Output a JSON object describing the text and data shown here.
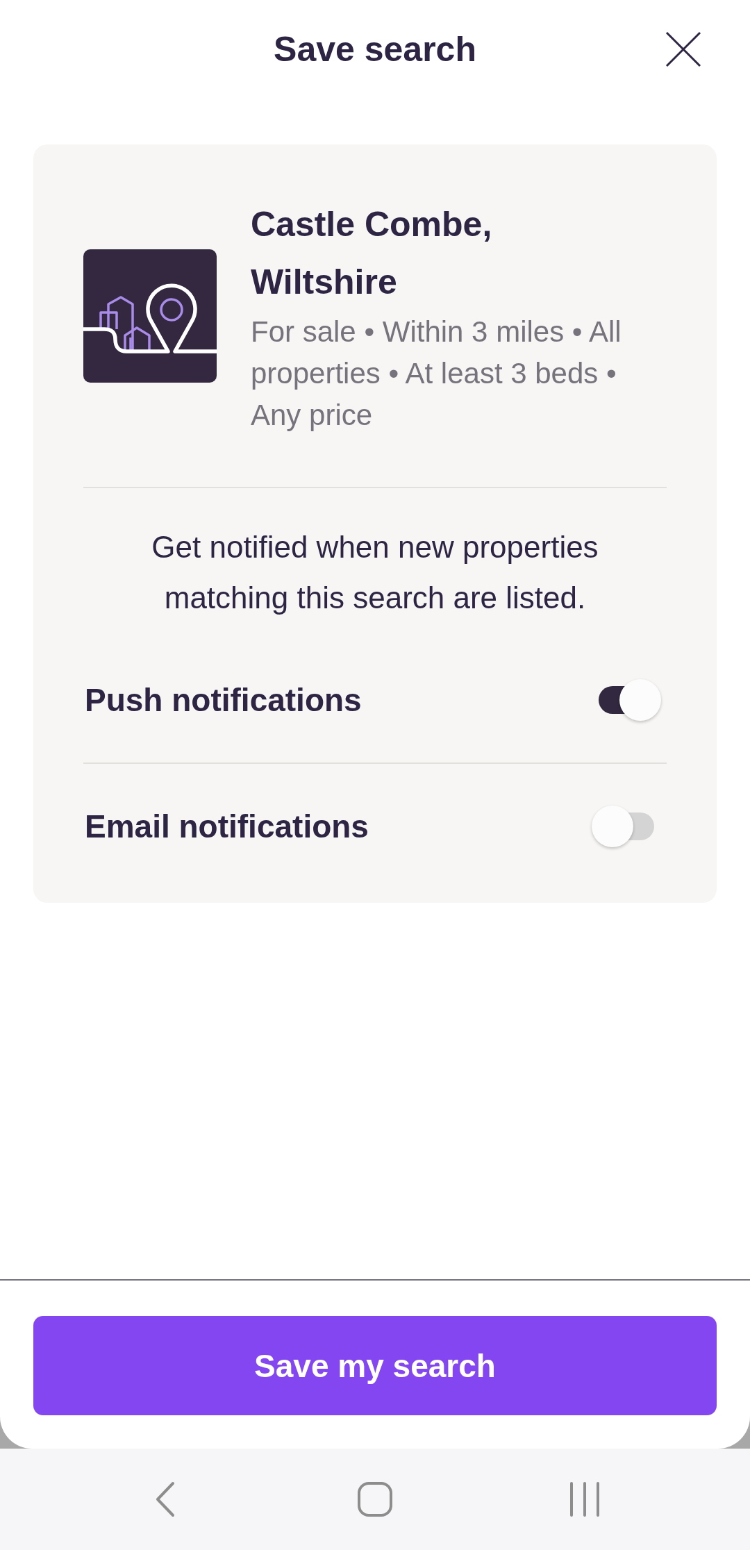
{
  "header": {
    "title": "Save search"
  },
  "search_card": {
    "location": "Castle Combe, Wiltshire",
    "criteria": "For sale • Within 3 miles • All properties • At least 3 beds • Any price",
    "description": "Get notified when new properties matching this search are listed.",
    "notifications": [
      {
        "label": "Push notifications",
        "on": true
      },
      {
        "label": "Email notifications",
        "on": false
      }
    ]
  },
  "save_button": {
    "label": "Save my search"
  }
}
